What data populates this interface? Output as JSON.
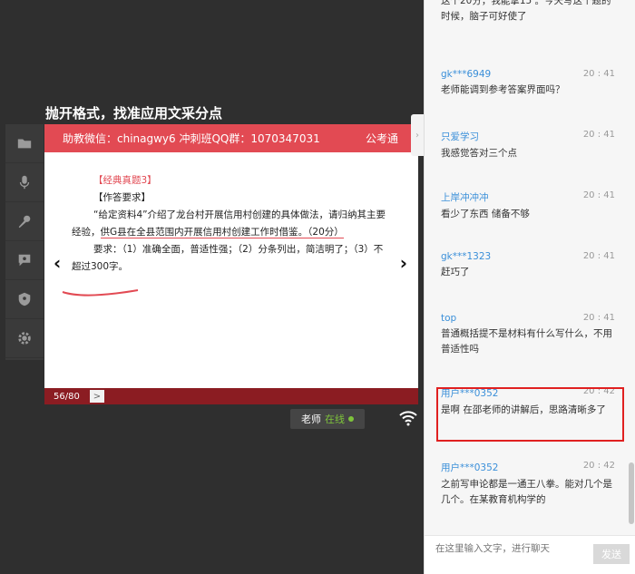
{
  "page_title": "抛开格式，找准应用文采分点",
  "toolbar": {
    "items": [
      {
        "icon": "folder-icon"
      },
      {
        "icon": "microphone-icon"
      },
      {
        "icon": "karaoke-mic-icon"
      },
      {
        "icon": "chat-bubble-icon"
      },
      {
        "icon": "shield-icon"
      },
      {
        "icon": "gear-icon"
      }
    ]
  },
  "slide": {
    "header_left": "助教微信：chinagwy6  冲刺班QQ群：1070347031",
    "header_right": "公考通",
    "lines": {
      "label": "【经典真题3】",
      "req": "【作答要求】",
      "p1": "“给定资料4”介绍了龙台村开展信用村创建的具体做法，请归纳其主要",
      "p2a": "经验，",
      "p2b": "供G县在全县范围内开展信用村创建工作时借鉴。（20分）",
      "p3": "要求：（1）准确全面，普适性强；（2）分条列出，简洁明了；（3）不",
      "p4": "超过300字。"
    },
    "page_indicator": "56/80",
    "next_label": ">",
    "nav_prev": "‹",
    "nav_next": "›"
  },
  "status": {
    "teacher_label": "老师",
    "online_label": "在线"
  },
  "chat": {
    "collapse_label": "›",
    "messages": [
      {
        "user": "",
        "time": "",
        "text": "这个20分，我能拿15 。今天写这个题的时候，脑子可好使了"
      },
      {
        "user": "gk***6949",
        "time": "20 : 41",
        "text": "老师能调到参考答案界面吗？"
      },
      {
        "user": "只爱学习",
        "time": "20 : 41",
        "text": "我感觉答对三个点"
      },
      {
        "user": "上岸冲冲冲",
        "time": "20 : 41",
        "text": "看少了东西 储备不够"
      },
      {
        "user": "gk***1323",
        "time": "20 : 41",
        "text": "赶巧了"
      },
      {
        "user": "top",
        "time": "20 : 41",
        "text": "普通概括提不是材料有什么写什么，不用普适性吗"
      },
      {
        "user": "用户***0352",
        "time": "20 : 42",
        "text": "是啊    在邵老师的讲解后，思路清晰多了"
      },
      {
        "user": "用户***0352",
        "time": "20 : 42",
        "text": "之前写申论都是一通王八拳。能对几个是几个。在某教育机构学的"
      }
    ],
    "input_placeholder": "在这里输入文字，进行聊天",
    "send_label": "发送"
  }
}
